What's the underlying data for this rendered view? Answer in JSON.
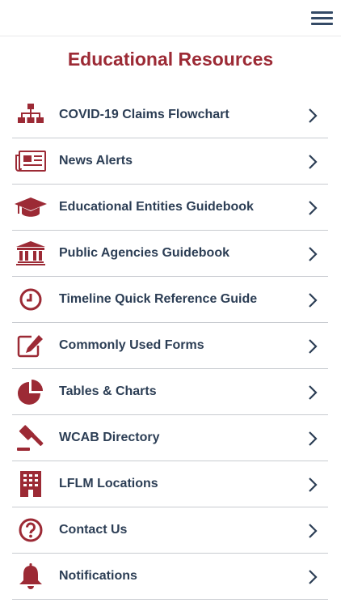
{
  "header": {
    "menu_icon": "hamburger-menu-icon"
  },
  "page": {
    "title": "Educational Resources"
  },
  "colors": {
    "accent": "#9c2a35",
    "text": "#2c3e55",
    "divider": "#c8cbd0"
  },
  "items": [
    {
      "label": "COVID-19 Claims Flowchart",
      "icon": "flowchart-icon"
    },
    {
      "label": "News Alerts",
      "icon": "newspaper-icon"
    },
    {
      "label": "Educational Entities Guidebook",
      "icon": "graduation-cap-icon"
    },
    {
      "label": "Public Agencies Guidebook",
      "icon": "government-building-icon"
    },
    {
      "label": "Timeline Quick Reference Guide",
      "icon": "clock-icon"
    },
    {
      "label": "Commonly Used Forms",
      "icon": "edit-form-icon"
    },
    {
      "label": "Tables & Charts",
      "icon": "pie-chart-icon"
    },
    {
      "label": "WCAB Directory",
      "icon": "gavel-icon"
    },
    {
      "label": "LFLM Locations",
      "icon": "office-building-icon"
    },
    {
      "label": "Contact Us",
      "icon": "question-circle-icon"
    },
    {
      "label": "Notifications",
      "icon": "bell-icon"
    }
  ]
}
